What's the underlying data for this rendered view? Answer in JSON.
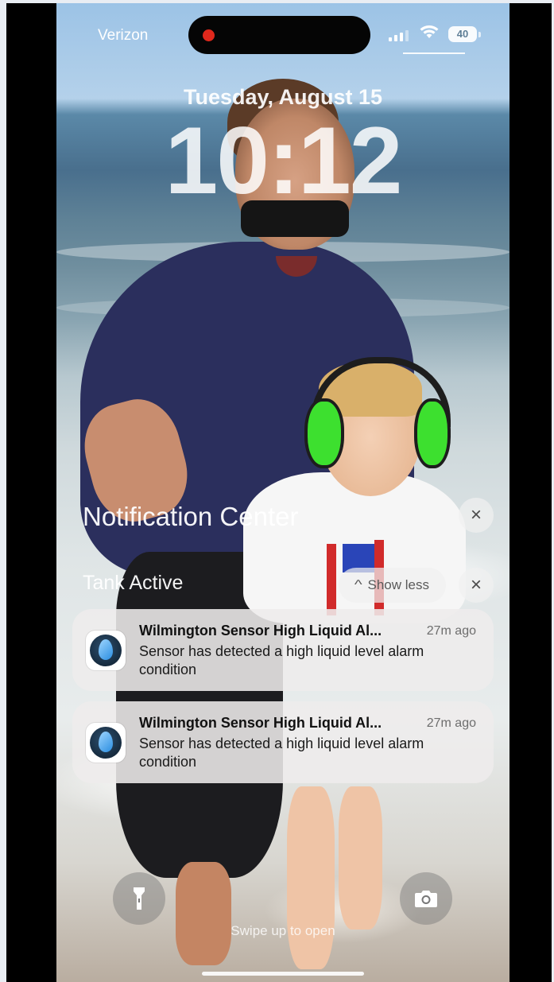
{
  "status_bar": {
    "carrier": "Verizon",
    "battery": "40"
  },
  "lock_screen": {
    "date": "Tuesday, August 15",
    "time": "10:12"
  },
  "notification_center": {
    "title": "Notification Center",
    "close_glyph": "×",
    "group": {
      "title": "Tank Active",
      "show_less_label": "Show less",
      "chevron": "^"
    },
    "notifications": [
      {
        "title": "Wilmington Sensor High Liquid Al...",
        "time": "27m ago",
        "body": "Sensor has detected a high liquid level alarm condition"
      },
      {
        "title": "Wilmington Sensor High Liquid Al...",
        "time": "27m ago",
        "body": "Sensor has detected a high liquid level alarm condition"
      }
    ]
  },
  "footer": {
    "hint": "Swipe up to open"
  },
  "icons": {
    "flashlight": "flashlight-icon",
    "camera": "camera-icon",
    "app": "water-drop-icon",
    "wifi": "wifi-icon",
    "signal": "cellular-signal-icon"
  },
  "colors": {
    "record_dot": "#e0281c",
    "headphones": "#3de02f"
  }
}
